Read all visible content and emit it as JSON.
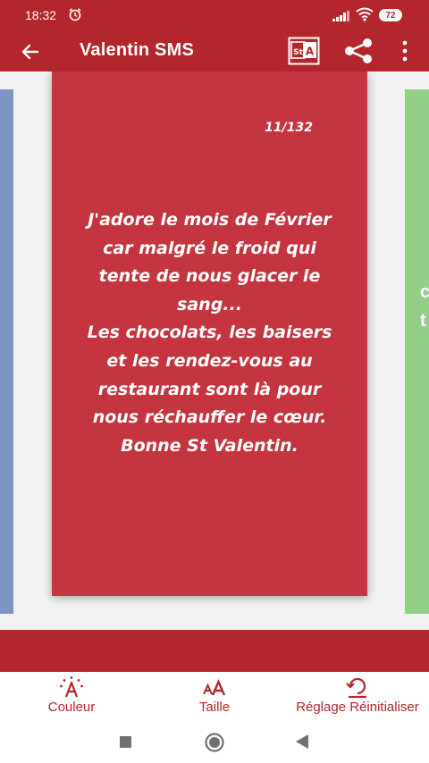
{
  "status": {
    "time": "18:32",
    "battery": "72"
  },
  "appbar": {
    "title": "Valentin SMS"
  },
  "card": {
    "counter": "11/132",
    "lines": [
      "J'adore le mois de Février",
      "car malgré le froid qui",
      "tente de nous glacer le",
      "sang...",
      "Les chocolats, les baisers",
      "et les rendez-vous au",
      "restaurant sont là pour",
      "nous réchauffer le cœur.",
      "Bonne St Valentin."
    ]
  },
  "side": {
    "right_chars": [
      "c",
      "t"
    ]
  },
  "toolbar": {
    "color_label": "Couleur",
    "size_label": "Taille",
    "reset_label": "Réglage Réinitialiser"
  },
  "colors": {
    "primary": "#b3262b",
    "card": "#c43540",
    "left_card": "#7c96c4",
    "right_card": "#93cf89"
  },
  "icons": {
    "back": "arrow-left-icon",
    "translate": "translate-icon",
    "share": "share-icon",
    "more": "more-vert-icon",
    "color": "color-palette-icon",
    "size": "text-size-icon",
    "reset": "reset-icon"
  }
}
